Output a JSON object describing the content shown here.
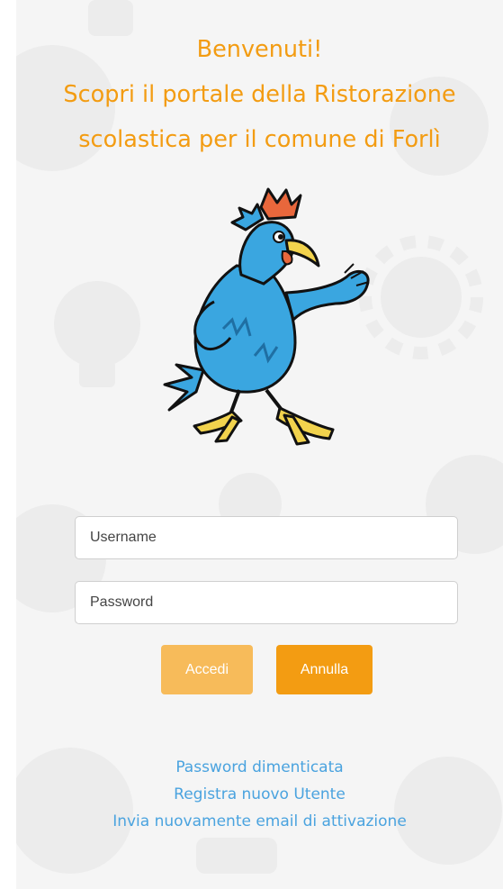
{
  "welcome": {
    "line1": "Benvenuti!",
    "line2": "Scopri il portale della Ristorazione",
    "line3": "scolastica per il comune di Forlì"
  },
  "mascot": {
    "icon": "rooster-mascot-icon"
  },
  "login_form": {
    "username_placeholder": "Username",
    "username_value": "",
    "password_placeholder": "Password",
    "password_value": "",
    "login_label": "Accedi",
    "cancel_label": "Annulla"
  },
  "links": {
    "forgot_password": "Password dimenticata",
    "register": "Registra nuovo Utente",
    "resend_activation": "Invia nuovamente email di attivazione"
  },
  "colors": {
    "accent": "#f39c12",
    "accent_light": "#f7bb5a",
    "link": "#4aa3df",
    "panel_bg": "#f5f5f5"
  }
}
